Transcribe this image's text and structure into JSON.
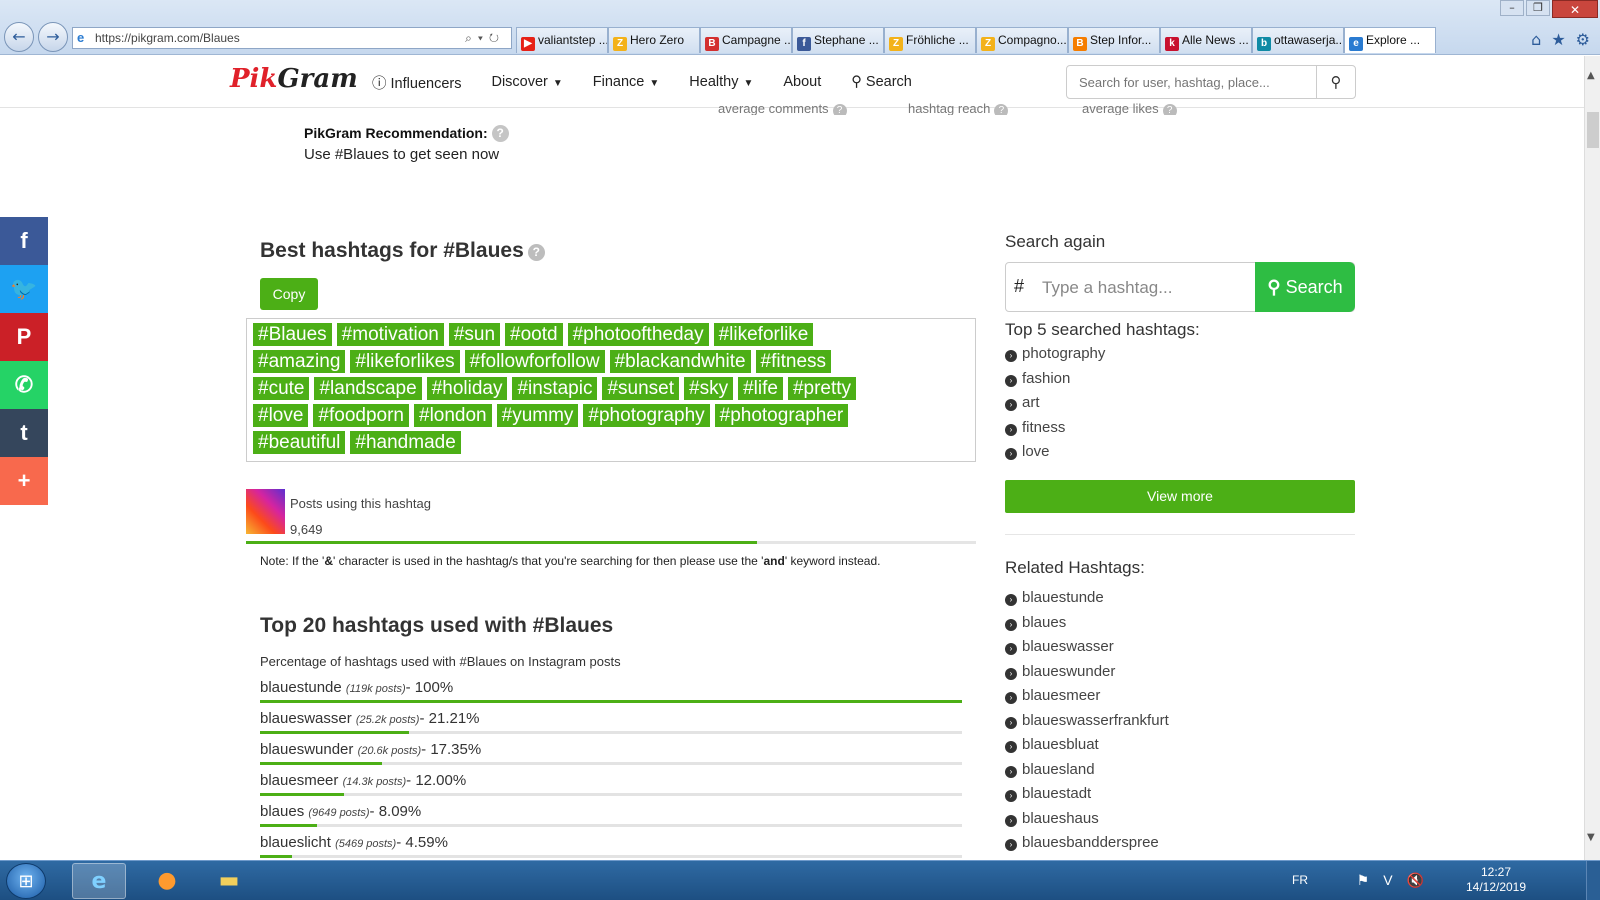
{
  "browser": {
    "url": "https://pikgram.com/Blaues",
    "tabs": [
      {
        "label": "valiantstep ...",
        "icon": "youtube-icon",
        "color": "#e62117",
        "glyph": "▶"
      },
      {
        "label": "Hero Zero",
        "icon": "z-icon",
        "color": "#f3b21a",
        "glyph": "Z"
      },
      {
        "label": "Campagne ...",
        "icon": "b-icon",
        "color": "#d32f2f",
        "glyph": "B"
      },
      {
        "label": "Stephane ...",
        "icon": "facebook-icon",
        "color": "#3b5998",
        "glyph": "f"
      },
      {
        "label": "Fröhliche ...",
        "icon": "z-icon",
        "color": "#f3b21a",
        "glyph": "Z"
      },
      {
        "label": "Compagno...",
        "icon": "z-icon",
        "color": "#f3b21a",
        "glyph": "Z"
      },
      {
        "label": "Step Infor...",
        "icon": "blogger-icon",
        "color": "#f57d00",
        "glyph": "B"
      },
      {
        "label": "Alle News ...",
        "icon": "k-icon",
        "color": "#c8102e",
        "glyph": "k"
      },
      {
        "label": "ottawaserja...",
        "icon": "bing-icon",
        "color": "#0f8aa5",
        "glyph": "b"
      },
      {
        "label": "Explore ...",
        "icon": "ie-icon",
        "color": "#2a7bd1",
        "glyph": "e",
        "active": true
      }
    ]
  },
  "site": {
    "logo_pik": "Pik",
    "logo_gram": "Gram",
    "nav": {
      "influencers": "Influencers",
      "discover": "Discover",
      "finance": "Finance",
      "healthy": "Healthy",
      "about": "About",
      "search": "Search"
    },
    "header_search_placeholder": "Search for user, hashtag, place..."
  },
  "stats_cut": {
    "avg_comments": "average comments",
    "hashtag_reach": "hashtag reach",
    "avg_likes": "average likes"
  },
  "recommendation": {
    "title": "PikGram Recommendation:",
    "text": "Use #Blaues to get seen now"
  },
  "social": [
    {
      "name": "facebook",
      "glyph": "f",
      "color": "#3b5998"
    },
    {
      "name": "twitter",
      "glyph": "🐦",
      "color": "#1da1f2"
    },
    {
      "name": "pinterest",
      "glyph": "P",
      "color": "#cb2027"
    },
    {
      "name": "whatsapp",
      "glyph": "✆",
      "color": "#25d366"
    },
    {
      "name": "tumblr",
      "glyph": "t",
      "color": "#35465c"
    },
    {
      "name": "more",
      "glyph": "+",
      "color": "#f8694d"
    }
  ],
  "best": {
    "title": "Best hashtags for #Blaues",
    "copy_label": "Copy",
    "tag_lines": [
      [
        "#Blaues",
        "#motivation",
        "#sun",
        "#ootd",
        "#photooftheday",
        "#likeforlike"
      ],
      [
        "#amazing",
        "#likeforlikes",
        "#followforfollow",
        "#blackandwhite",
        "#fitness"
      ],
      [
        "#cute",
        "#landscape",
        "#holiday",
        "#instapic",
        "#sunset",
        "#sky",
        "#life",
        "#pretty"
      ],
      [
        "#love",
        "#foodporn",
        "#london",
        "#yummy",
        "#photography",
        "#photographer"
      ],
      [
        "#beautiful",
        "#handmade"
      ]
    ]
  },
  "posts": {
    "label": "Posts using this hashtag",
    "value": "9,649",
    "bar_fraction": 0.7
  },
  "note": {
    "prefix": "Note: If the '",
    "amp": "&",
    "middle": "' character is used in the hashtag/s that you're searching for then please use the '",
    "and": "and",
    "suffix": "' keyword instead."
  },
  "top20": {
    "title": "Top 20 hashtags used with #Blaues",
    "description": "Percentage of hashtags used with #Blaues on Instagram posts",
    "rows": [
      {
        "name": "blauestunde",
        "posts": "(119k posts)",
        "pct": "- 100%",
        "value": 100
      },
      {
        "name": "blaueswasser",
        "posts": "(25.2k posts)",
        "pct": "- 21.21%",
        "value": 21.21
      },
      {
        "name": "blaueswunder",
        "posts": "(20.6k posts)",
        "pct": "- 17.35%",
        "value": 17.35
      },
      {
        "name": "blauesmeer",
        "posts": "(14.3k posts)",
        "pct": "- 12.00%",
        "value": 12.0
      },
      {
        "name": "blaues",
        "posts": "(9649 posts)",
        "pct": "- 8.09%",
        "value": 8.09
      },
      {
        "name": "blaueslicht",
        "posts": "(5469 posts)",
        "pct": "- 4.59%",
        "value": 4.59
      }
    ]
  },
  "sidebar": {
    "search_again": "Search again",
    "hash_symbol": "#",
    "search_placeholder": "Type a hashtag...",
    "search_button": "Search",
    "top5_title": "Top 5 searched hashtags:",
    "top5": [
      "photography",
      "fashion",
      "art",
      "fitness",
      "love"
    ],
    "view_more": "View more",
    "related_title": "Related Hashtags:",
    "related": [
      "blauestunde",
      "blaues",
      "blaueswasser",
      "blaueswunder",
      "blauesmeer",
      "blaueswasserfrankfurt",
      "blauesbluat",
      "blauesland",
      "blauestadt",
      "blaueshaus",
      "blauesbandderspree"
    ]
  },
  "taskbar": {
    "lang": "FR",
    "time": "12:27",
    "date": "14/12/2019"
  },
  "colors": {
    "accent_green": "#4caf16",
    "search_green": "#2ebd43",
    "logo_red": "#e0212a"
  }
}
